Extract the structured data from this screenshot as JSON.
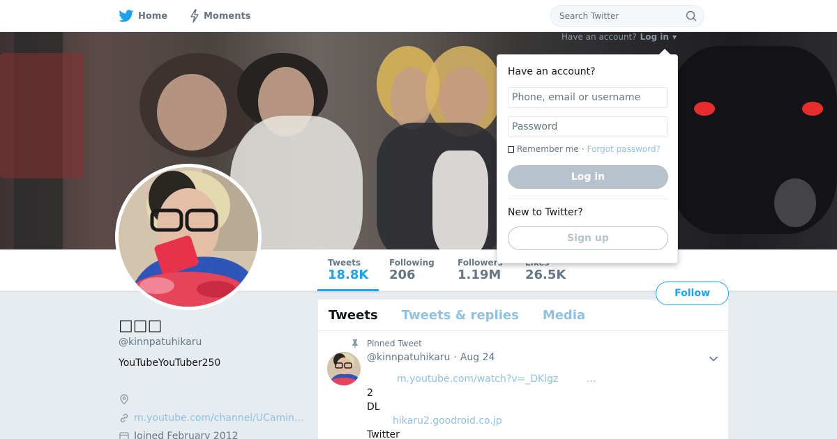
{
  "nav": {
    "home_label": "Home",
    "moments_label": "Moments",
    "search_placeholder": "Search Twitter"
  },
  "login_prompt": {
    "text": "Have an account?",
    "link": "Log in"
  },
  "profile": {
    "display_name": "□□□",
    "screen_name": "@kinnpatuhikaru",
    "bio": "YouTubeYouTuber250",
    "location": "",
    "url": "m.youtube.com/channel/UCamin…",
    "joined": "Joined February 2012"
  },
  "stats": [
    {
      "label": "Tweets",
      "value": "18.8K"
    },
    {
      "label": "Following",
      "value": "206"
    },
    {
      "label": "Followers",
      "value": "1.19M"
    },
    {
      "label": "Likes",
      "value": "26.5K"
    }
  ],
  "follow_label": "Follow",
  "timeline": {
    "tabs": [
      "Tweets",
      "Tweets & replies",
      "Media"
    ],
    "tweet": {
      "pinned_label": "Pinned Tweet",
      "handle": "@kinnpatuhikaru",
      "separator": "·",
      "date": "Aug 24",
      "link1": "m.youtube.com/watch?v=_DKigz",
      "link1_ellipsis": "…",
      "line2": "2",
      "line3": "DL",
      "link2": "hikaru2.goodroid.co.jp",
      "line4": "Twitter"
    }
  },
  "login_dropdown": {
    "title": "Have an account?",
    "username_placeholder": "Phone, email or username",
    "password_placeholder": "Password",
    "remember_label": "Remember me",
    "separator": "·",
    "forgot_label": "Forgot password?",
    "login_button": "Log in",
    "new_label": "New to Twitter?",
    "signup_button": "Sign up"
  },
  "colors": {
    "accent": "#1da1f2",
    "muted": "#657786",
    "background": "#e6ecf0"
  },
  "icons": [
    "twitter-bird-icon",
    "lightning-icon",
    "search-icon",
    "pin-icon",
    "location-icon",
    "link-icon",
    "calendar-icon",
    "chevron-down-icon"
  ]
}
